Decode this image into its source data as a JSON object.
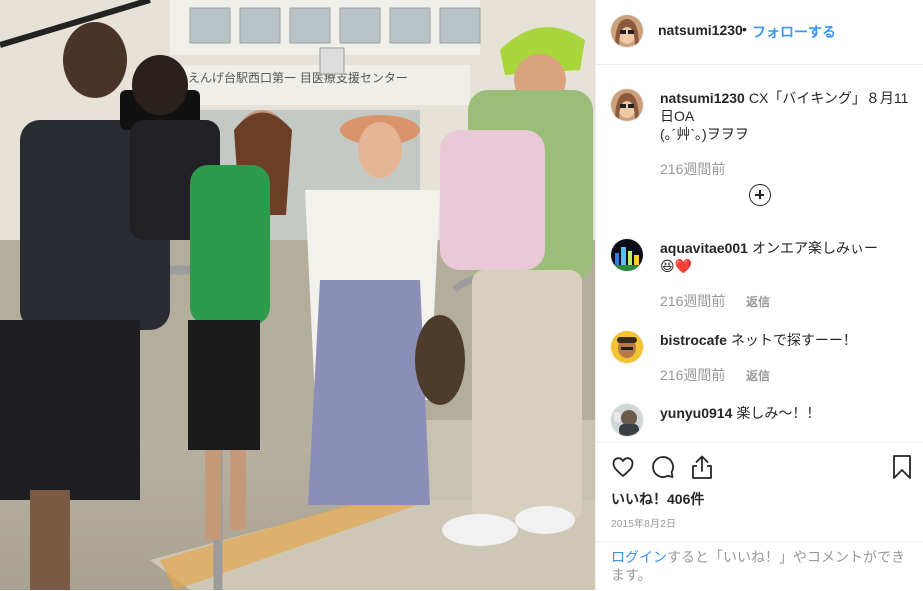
{
  "post": {
    "author": "natsumi1230",
    "follow_dot": "•",
    "follow_label": "フォローする",
    "caption_user": "natsumi1230",
    "caption_line1": "CX「バイキング」８月11日OA",
    "caption_line2": "(｡´艸`｡)ヲヲヲ",
    "caption_time": "216週間前",
    "likes": "いいね！406件",
    "date": "2015年8月2日"
  },
  "comments": [
    {
      "user": "aquavitae001",
      "text": "オンエア楽しみぃー",
      "emoji": "😆❤️",
      "time": "216週間前",
      "reply_label": "返信"
    },
    {
      "user": "bistrocafe",
      "text": "ネットで探すーー！",
      "time": "216週間前",
      "reply_label": "返信"
    },
    {
      "user": "yunyu0914",
      "text": "楽しみ〜！！"
    }
  ],
  "footer": {
    "login_link": "ログイン",
    "login_rest": "すると「いいね！」やコメントができます。"
  },
  "photo_sign": {
    "line1": "〇〇〇〇〇〇〇〇〇〇",
    "line2": "えんげ台駅西口第一  目医療支援センター"
  },
  "icons": [
    "heart-icon",
    "comment-icon",
    "share-icon",
    "bookmark-icon",
    "plus-circle-icon"
  ],
  "colors": {
    "accent": "#3897f0",
    "text": "#262626",
    "muted": "#999999",
    "border": "#efefef"
  }
}
